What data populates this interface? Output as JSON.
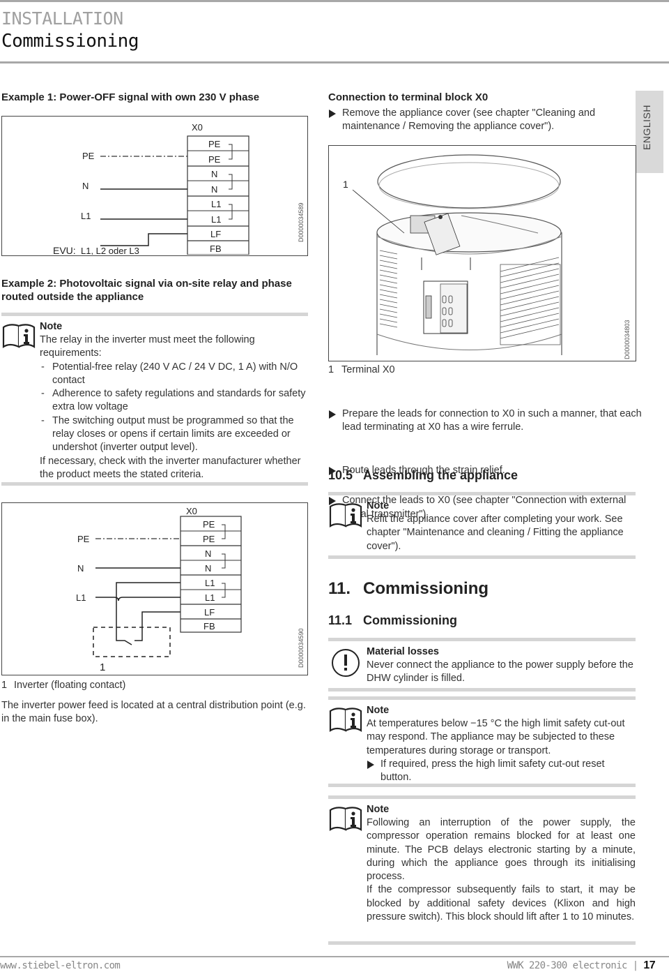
{
  "header": {
    "section": "INSTALLATION",
    "title": "Commissioning"
  },
  "language_tab": "ENGLISH",
  "example1": {
    "heading": "Example 1: Power-OFF signal with own 230 V phase",
    "diagram": {
      "terminal_label": "X0",
      "terminals": [
        "PE",
        "PE",
        "N",
        "N",
        "L1",
        "L1",
        "LF",
        "FB"
      ],
      "wire_labels": [
        "PE",
        "N",
        "L1"
      ],
      "evu_label": "EVU:",
      "evu_value": "L1, L2 oder L3",
      "doc_id": "D0000034589"
    }
  },
  "example2": {
    "heading": "Example 2: Photovoltaic signal via on-site relay and phase routed outside the appliance",
    "note": {
      "icon": "book-info-icon",
      "title": "Note",
      "intro": "The relay in the inverter must meet the following requirements:",
      "items": [
        "Potential-free relay (240 V AC / 24 V DC, 1 A) with N/O contact",
        "Adherence to safety regulations and standards for safety extra low voltage",
        "The switching output must be programmed so that the relay closes or opens if certain limits are exceeded or undershot (inverter output level)."
      ],
      "footer": "If necessary, check with the inverter manufacturer whether the product meets the stated criteria."
    },
    "diagram": {
      "terminal_label": "X0",
      "terminals": [
        "PE",
        "PE",
        "N",
        "N",
        "L1",
        "L1",
        "LF",
        "FB"
      ],
      "wire_labels": [
        "PE",
        "N",
        "L1"
      ],
      "callout": "1",
      "doc_id": "D0000034590"
    },
    "legend": {
      "num": "1",
      "text": "Inverter (floating contact)"
    },
    "paragraph": "The inverter power feed is located at a central distribution point (e.g. in the main fuse box)."
  },
  "connection": {
    "heading": "Connection to terminal block X0",
    "step1": "Remove the appliance cover (see chapter \"Cleaning and maintenance / Removing the appliance cover\").",
    "figure": {
      "callout": "1",
      "doc_id": "D0000034803"
    },
    "legend": {
      "num": "1",
      "text": "Terminal X0"
    },
    "steps": [
      "Prepare the leads for connection to X0 in such a manner, that each lead terminating at X0 has a wire ferrule.",
      "Route leads through the strain relief.",
      "Connect the leads to X0 (see chapter \"Connection with external signal transmitter\")."
    ]
  },
  "section_10_5": {
    "num": "10.5",
    "title": "Assembling the appliance",
    "note": {
      "icon": "book-info-icon",
      "title": "Note",
      "text": "Refit the appliance cover after completing your work. See chapter \"Maintenance and cleaning / Fitting the appliance cover\")."
    }
  },
  "section_11": {
    "num": "11.",
    "title": "Commissioning"
  },
  "section_11_1": {
    "num": "11.1",
    "title": "Commissioning",
    "warning": {
      "icon": "exclamation-circle-icon",
      "title": "Material losses",
      "text": "Never connect the appliance to the power supply before the DHW cylinder is filled."
    },
    "note1": {
      "icon": "book-info-icon",
      "title": "Note",
      "text": "At temperatures below −15 °C the high limit safety cut-out may respond. The appliance may be subjected to these temperatures during storage or transport.",
      "step": "If required, press the high limit safety cut-out reset button."
    },
    "note2": {
      "icon": "book-info-icon",
      "title": "Note",
      "text1": "Following an interruption of the power supply, the compressor operation remains blocked for at least one minute. The PCB delays electronic starting by a minute, during which the appliance goes through its initialising process.",
      "text2": "If the compressor subsequently fails to start, it may be blocked by additional safety devices (Klixon and high pressure switch). This block should lift after 1 to 10 minutes."
    }
  },
  "footer": {
    "url": "www.stiebel-eltron.com",
    "product": "WWK 220-300 electronic",
    "separator": "|",
    "page": "17"
  }
}
